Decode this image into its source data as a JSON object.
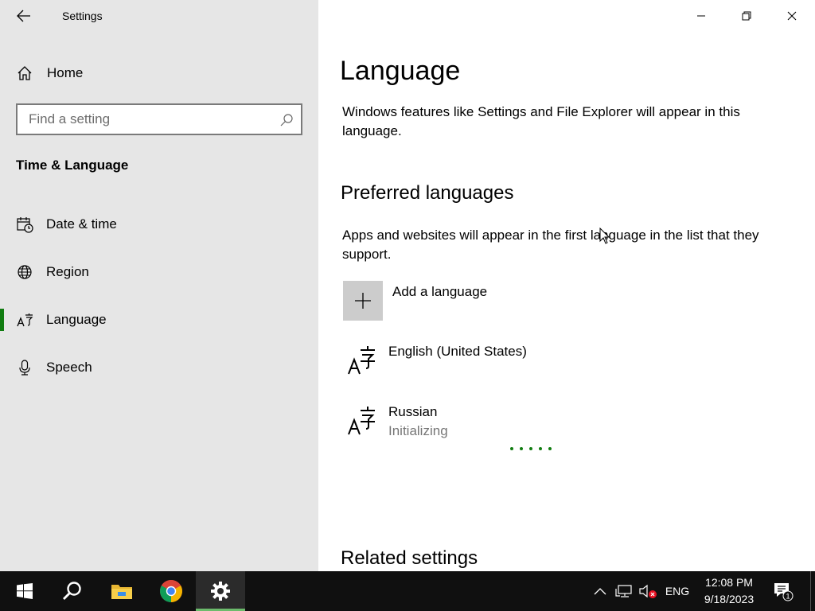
{
  "window": {
    "title": "Settings"
  },
  "sidebar": {
    "home_label": "Home",
    "search_placeholder": "Find a setting",
    "section_title": "Time & Language",
    "items": [
      {
        "label": "Date & time",
        "icon": "calendar-clock-icon"
      },
      {
        "label": "Region",
        "icon": "globe-icon"
      },
      {
        "label": "Language",
        "icon": "language-icon",
        "active": true
      },
      {
        "label": "Speech",
        "icon": "microphone-icon"
      }
    ]
  },
  "main": {
    "title": "Language",
    "windows_display_desc": "Windows features like Settings and File Explorer will appear in this language.",
    "preferred_heading": "Preferred languages",
    "preferred_desc": "Apps and websites will appear in the first language in the list that they support.",
    "add_language_label": "Add a language",
    "languages": [
      {
        "name": "English (United States)",
        "status": ""
      },
      {
        "name": "Russian",
        "status": "Initializing"
      }
    ],
    "related_heading": "Related settings"
  },
  "taskbar": {
    "apps": [
      "start-button",
      "search-button",
      "file-explorer",
      "chrome",
      "settings"
    ],
    "input_language": "ENG",
    "time": "12:08 PM",
    "date": "9/18/2023",
    "notification_count": "1"
  },
  "colors": {
    "accent": "#107c10",
    "sidebar_bg": "#e6e6e6",
    "taskbar_bg": "#101010"
  }
}
